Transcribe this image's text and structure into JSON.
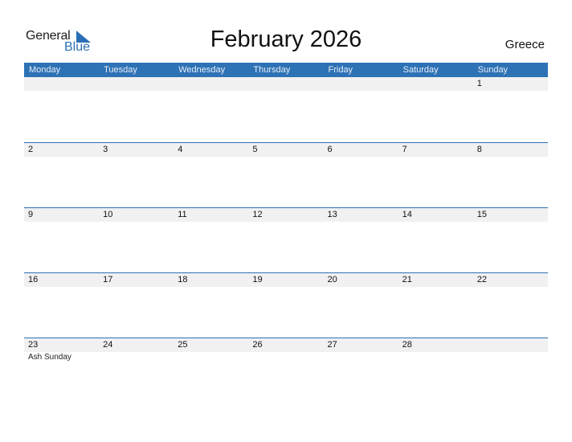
{
  "logo": {
    "word1": "General",
    "word2": "Blue"
  },
  "title": "February 2026",
  "country": "Greece",
  "colors": {
    "accent": "#2d72b5",
    "band": "#f1f1f1"
  },
  "weekdays": [
    "Monday",
    "Tuesday",
    "Wednesday",
    "Thursday",
    "Friday",
    "Saturday",
    "Sunday"
  ],
  "weeks": [
    {
      "days": [
        "",
        "",
        "",
        "",
        "",
        "",
        "1"
      ],
      "holidays": []
    },
    {
      "days": [
        "2",
        "3",
        "4",
        "5",
        "6",
        "7",
        "8"
      ],
      "holidays": []
    },
    {
      "days": [
        "9",
        "10",
        "11",
        "12",
        "13",
        "14",
        "15"
      ],
      "holidays": []
    },
    {
      "days": [
        "16",
        "17",
        "18",
        "19",
        "20",
        "21",
        "22"
      ],
      "holidays": []
    },
    {
      "days": [
        "23",
        "24",
        "25",
        "26",
        "27",
        "28",
        ""
      ],
      "holidays": [
        {
          "day": "23",
          "name": "Ash Sunday"
        }
      ]
    }
  ]
}
